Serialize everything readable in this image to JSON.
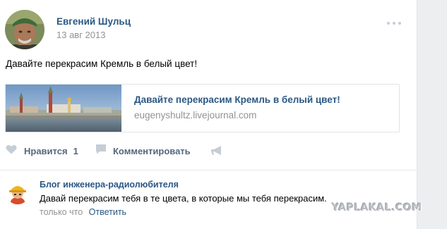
{
  "post": {
    "author": "Евгений Шульц",
    "date": "13 авг 2013",
    "text": "Давайте перекрасим Кремль в белый цвет!",
    "more_icon": "ellipsis-icon"
  },
  "snippet": {
    "title": "Давайте перекрасим Кремль в белый цвет!",
    "domain": "eugenyshultz.livejournal.com"
  },
  "actions": {
    "like_label": "Нравится",
    "like_count": "1",
    "comment_label": "Комментировать",
    "like_icon": "heart-icon",
    "comment_icon": "speech-bubble-icon",
    "share_icon": "megaphone-icon"
  },
  "reply": {
    "author": "Блог инженера-радиолюбителя",
    "text": "Давай перекрасим тебя в те цвета, в которые мы тебя перекрасим.",
    "time": "только что",
    "answer_label": "Ответить"
  },
  "watermark": "YAPLAKAL.COM",
  "colors": {
    "link": "#2a5885",
    "muted": "#939393",
    "action": "#55677d",
    "icon": "#c5cdd6",
    "border": "#dfe3e8"
  }
}
